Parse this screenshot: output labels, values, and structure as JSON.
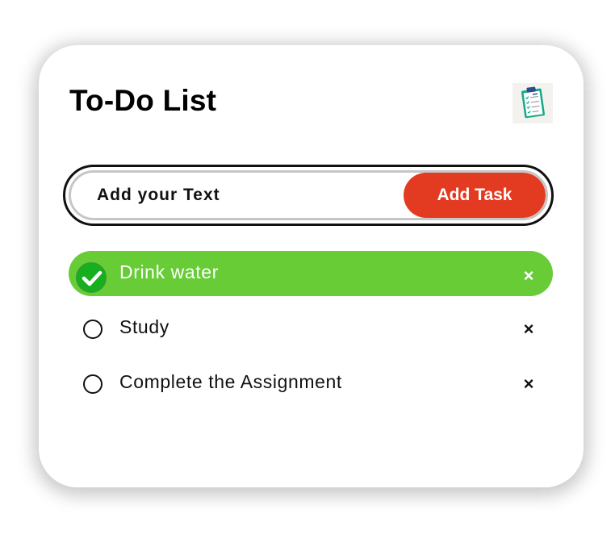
{
  "app": {
    "title": "To-Do List",
    "icon": "clipboard-checklist-icon"
  },
  "input": {
    "placeholder": "Add your Text",
    "value": "",
    "add_button_label": "Add Task"
  },
  "tasks": [
    {
      "label": "Drink water",
      "done": true,
      "delete_symbol": "×"
    },
    {
      "label": "Study",
      "done": false,
      "delete_symbol": "×"
    },
    {
      "label": "Complete the Assignment",
      "done": false,
      "delete_symbol": "×"
    }
  ],
  "colors": {
    "accent_button": "#e33b22",
    "done_task_background": "#68cc37",
    "done_check": "#16b01e",
    "card_background": "#ffffff",
    "text": "#111111"
  }
}
